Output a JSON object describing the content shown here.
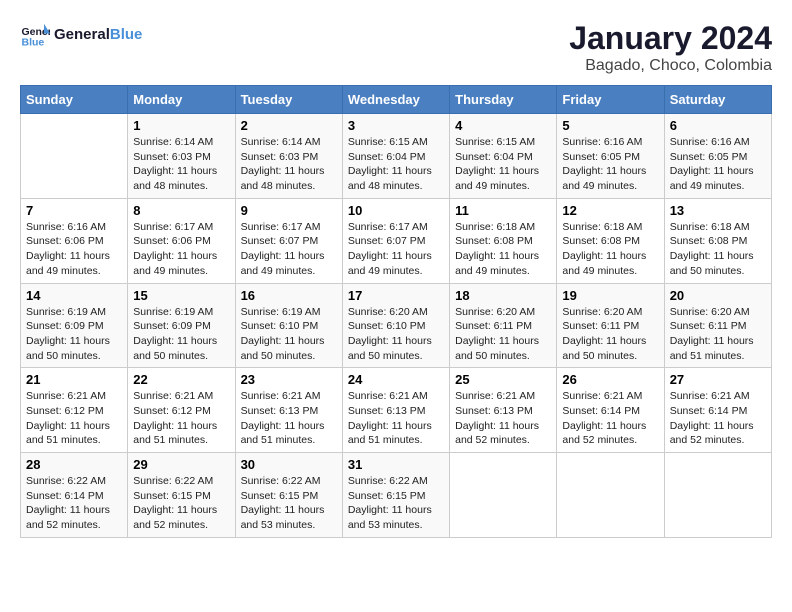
{
  "logo": {
    "text_general": "General",
    "text_blue": "Blue"
  },
  "title": "January 2024",
  "subtitle": "Bagado, Choco, Colombia",
  "days_of_week": [
    "Sunday",
    "Monday",
    "Tuesday",
    "Wednesday",
    "Thursday",
    "Friday",
    "Saturday"
  ],
  "weeks": [
    [
      {
        "day": "",
        "info": ""
      },
      {
        "day": "1",
        "info": "Sunrise: 6:14 AM\nSunset: 6:03 PM\nDaylight: 11 hours\nand 48 minutes."
      },
      {
        "day": "2",
        "info": "Sunrise: 6:14 AM\nSunset: 6:03 PM\nDaylight: 11 hours\nand 48 minutes."
      },
      {
        "day": "3",
        "info": "Sunrise: 6:15 AM\nSunset: 6:04 PM\nDaylight: 11 hours\nand 48 minutes."
      },
      {
        "day": "4",
        "info": "Sunrise: 6:15 AM\nSunset: 6:04 PM\nDaylight: 11 hours\nand 49 minutes."
      },
      {
        "day": "5",
        "info": "Sunrise: 6:16 AM\nSunset: 6:05 PM\nDaylight: 11 hours\nand 49 minutes."
      },
      {
        "day": "6",
        "info": "Sunrise: 6:16 AM\nSunset: 6:05 PM\nDaylight: 11 hours\nand 49 minutes."
      }
    ],
    [
      {
        "day": "7",
        "info": "Sunrise: 6:16 AM\nSunset: 6:06 PM\nDaylight: 11 hours\nand 49 minutes."
      },
      {
        "day": "8",
        "info": "Sunrise: 6:17 AM\nSunset: 6:06 PM\nDaylight: 11 hours\nand 49 minutes."
      },
      {
        "day": "9",
        "info": "Sunrise: 6:17 AM\nSunset: 6:07 PM\nDaylight: 11 hours\nand 49 minutes."
      },
      {
        "day": "10",
        "info": "Sunrise: 6:17 AM\nSunset: 6:07 PM\nDaylight: 11 hours\nand 49 minutes."
      },
      {
        "day": "11",
        "info": "Sunrise: 6:18 AM\nSunset: 6:08 PM\nDaylight: 11 hours\nand 49 minutes."
      },
      {
        "day": "12",
        "info": "Sunrise: 6:18 AM\nSunset: 6:08 PM\nDaylight: 11 hours\nand 49 minutes."
      },
      {
        "day": "13",
        "info": "Sunrise: 6:18 AM\nSunset: 6:08 PM\nDaylight: 11 hours\nand 50 minutes."
      }
    ],
    [
      {
        "day": "14",
        "info": "Sunrise: 6:19 AM\nSunset: 6:09 PM\nDaylight: 11 hours\nand 50 minutes."
      },
      {
        "day": "15",
        "info": "Sunrise: 6:19 AM\nSunset: 6:09 PM\nDaylight: 11 hours\nand 50 minutes."
      },
      {
        "day": "16",
        "info": "Sunrise: 6:19 AM\nSunset: 6:10 PM\nDaylight: 11 hours\nand 50 minutes."
      },
      {
        "day": "17",
        "info": "Sunrise: 6:20 AM\nSunset: 6:10 PM\nDaylight: 11 hours\nand 50 minutes."
      },
      {
        "day": "18",
        "info": "Sunrise: 6:20 AM\nSunset: 6:11 PM\nDaylight: 11 hours\nand 50 minutes."
      },
      {
        "day": "19",
        "info": "Sunrise: 6:20 AM\nSunset: 6:11 PM\nDaylight: 11 hours\nand 50 minutes."
      },
      {
        "day": "20",
        "info": "Sunrise: 6:20 AM\nSunset: 6:11 PM\nDaylight: 11 hours\nand 51 minutes."
      }
    ],
    [
      {
        "day": "21",
        "info": "Sunrise: 6:21 AM\nSunset: 6:12 PM\nDaylight: 11 hours\nand 51 minutes."
      },
      {
        "day": "22",
        "info": "Sunrise: 6:21 AM\nSunset: 6:12 PM\nDaylight: 11 hours\nand 51 minutes."
      },
      {
        "day": "23",
        "info": "Sunrise: 6:21 AM\nSunset: 6:13 PM\nDaylight: 11 hours\nand 51 minutes."
      },
      {
        "day": "24",
        "info": "Sunrise: 6:21 AM\nSunset: 6:13 PM\nDaylight: 11 hours\nand 51 minutes."
      },
      {
        "day": "25",
        "info": "Sunrise: 6:21 AM\nSunset: 6:13 PM\nDaylight: 11 hours\nand 52 minutes."
      },
      {
        "day": "26",
        "info": "Sunrise: 6:21 AM\nSunset: 6:14 PM\nDaylight: 11 hours\nand 52 minutes."
      },
      {
        "day": "27",
        "info": "Sunrise: 6:21 AM\nSunset: 6:14 PM\nDaylight: 11 hours\nand 52 minutes."
      }
    ],
    [
      {
        "day": "28",
        "info": "Sunrise: 6:22 AM\nSunset: 6:14 PM\nDaylight: 11 hours\nand 52 minutes."
      },
      {
        "day": "29",
        "info": "Sunrise: 6:22 AM\nSunset: 6:15 PM\nDaylight: 11 hours\nand 52 minutes."
      },
      {
        "day": "30",
        "info": "Sunrise: 6:22 AM\nSunset: 6:15 PM\nDaylight: 11 hours\nand 53 minutes."
      },
      {
        "day": "31",
        "info": "Sunrise: 6:22 AM\nSunset: 6:15 PM\nDaylight: 11 hours\nand 53 minutes."
      },
      {
        "day": "",
        "info": ""
      },
      {
        "day": "",
        "info": ""
      },
      {
        "day": "",
        "info": ""
      }
    ]
  ]
}
